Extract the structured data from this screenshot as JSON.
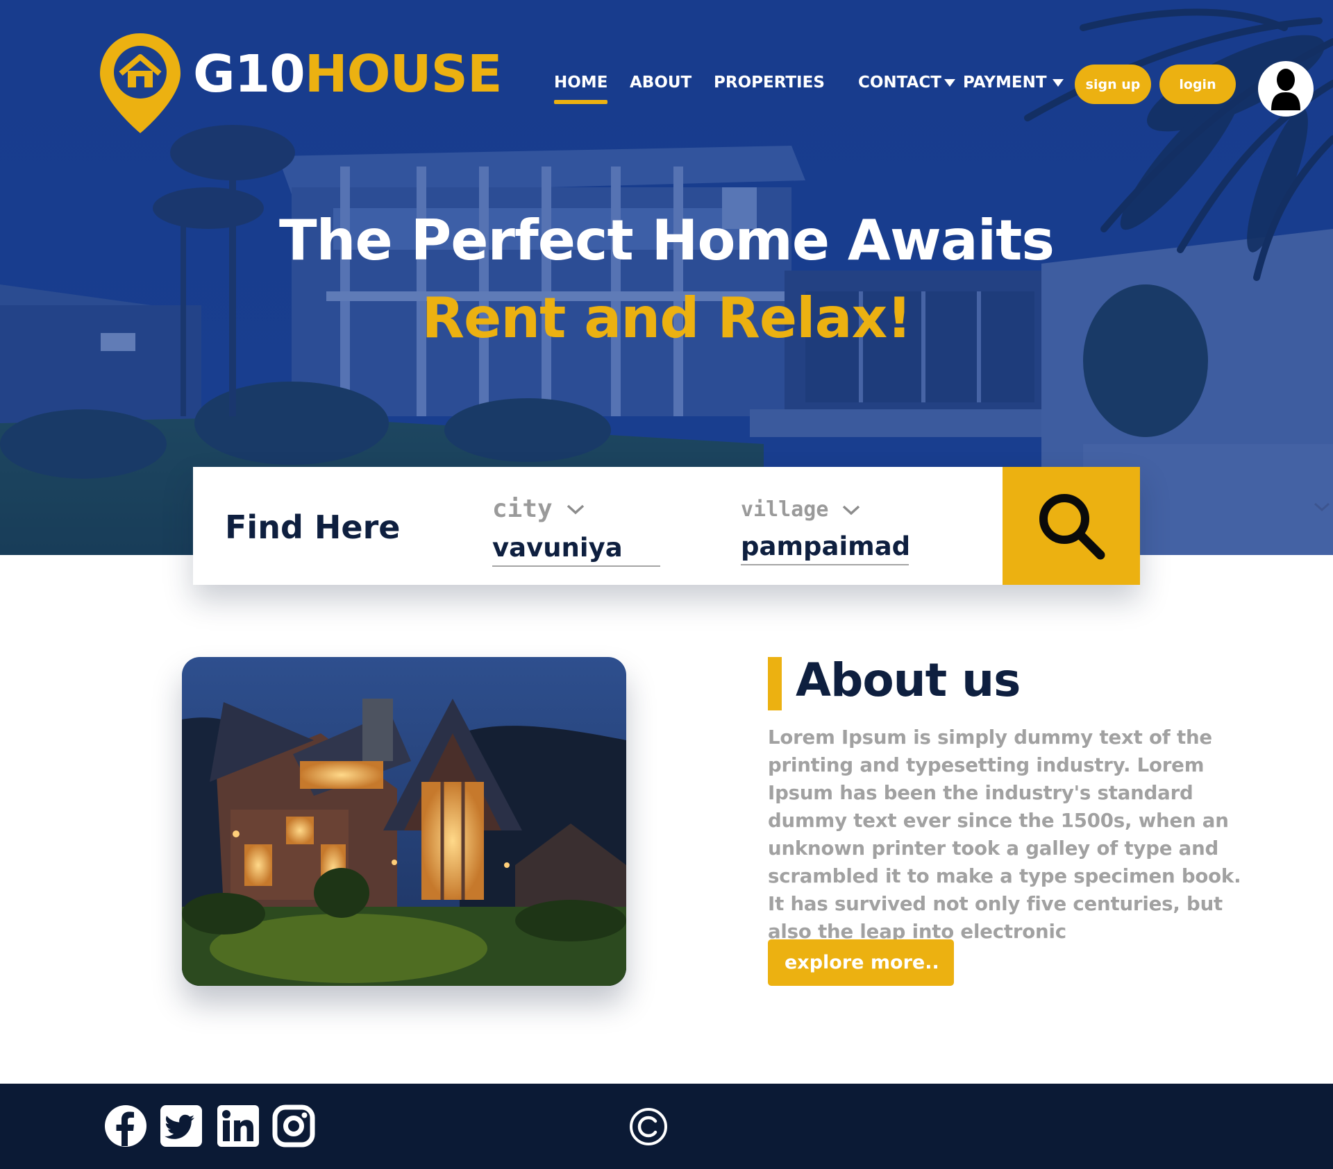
{
  "brand": {
    "name_part1": "G10",
    "name_part2": "HOUSE",
    "logo_icon": "location-pin-house-icon"
  },
  "colors": {
    "accent": "#ecb111",
    "navy": "#0e1f3f",
    "hero_blue": "#1b3f8c",
    "footer": "#0b1a35",
    "muted_text": "#a1a1a1"
  },
  "nav": {
    "items": [
      {
        "label": "HOME",
        "active": true
      },
      {
        "label": "ABOUT",
        "active": false
      },
      {
        "label": "PROPERTIES",
        "active": false
      },
      {
        "label": "CONTACT",
        "active": false,
        "dropdown": true
      },
      {
        "label": "PAYMENT",
        "active": false,
        "dropdown": true
      }
    ],
    "signup_label": "sign up",
    "login_label": "login",
    "avatar_icon": "user-avatar-icon"
  },
  "hero": {
    "title_line1": "The Perfect Home Awaits",
    "title_line2": "Rent and Relax!"
  },
  "search": {
    "heading": "Find Here",
    "city": {
      "label": "city",
      "value": "vavuniya"
    },
    "village": {
      "label": "village",
      "value": "pampaimadu"
    },
    "button_icon": "search-icon"
  },
  "about": {
    "title": "About us",
    "text": "Lorem Ipsum is simply dummy text of the printing and typesetting industry. Lorem Ipsum has been the industry's standard dummy text ever since the 1500s, when an unknown printer took a galley of type and scrambled it to make a type specimen book. It has survived not only five centuries, but also the leap into electronic",
    "button_label": "explore more.."
  },
  "footer": {
    "social_icons": [
      "facebook-icon",
      "twitter-icon",
      "linkedin-icon",
      "instagram-icon"
    ],
    "copyright_icon": "copyright-icon"
  }
}
